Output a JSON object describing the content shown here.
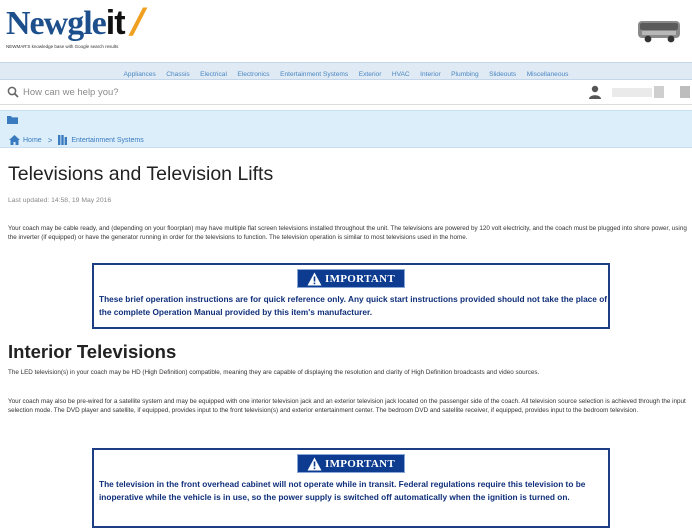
{
  "header": {
    "logo_main": "Newgle",
    "logo_it": "it",
    "logo_tagline": "NEWMAR'S knowledge base with Google search results"
  },
  "categories": [
    "Appliances",
    "Chassis",
    "Electrical",
    "Electronics",
    "Entertainment Systems",
    "Exterior",
    "HVAC",
    "Interior",
    "Plumbing",
    "Slideouts",
    "Miscellaneous"
  ],
  "search": {
    "placeholder": "How can we help you?"
  },
  "breadcrumb": {
    "home": "Home",
    "current": "Entertainment Systems"
  },
  "article": {
    "title": "Televisions and Television Lifts",
    "updated": "Last updated: 14:58, 19 May 2016",
    "intro": "Your coach may be cable ready, and (depending on your floorplan) may have multiple flat screen televisions installed throughout the unit.  The televisions are powered by 120 volt electricity, and the coach must be plugged into shore power, using  the inverter (if equipped) or have the generator running in order for the televisions to function. The television operation is similar to most televisions used in the home.",
    "important_label": "IMPORTANT",
    "important_1": "These brief operation instructions are for quick reference only. Any quick start instructions provided should not take the place of the complete Operation Manual provided by this item's manufacturer.",
    "section_title": "Interior Televisions",
    "para_led": "The LED television(s) in your coach may be HD (High Definition) compatible, meaning they are capable of displaying the resolution and clarity of High Definition broadcasts and video sources.",
    "para_satellite": "Your coach may also be pre-wired for a satellite system and may be equipped with one interior television jack and an exterior television jack located on the passenger side of the coach.  All television source selection is achieved through the input selection mode. The DVD player and satellite, if equipped, provides input to the front television(s) and exterior entertainment center. The bedroom DVD and satellite receiver, if equipped, provides input to the bedroom television.",
    "important_2": "The television in the front overhead cabinet will not operate while in transit. Federal regulations require this television to be inoperative while the vehicle is in use, so the power supply is switched off automatically when the ignition is turned on."
  },
  "colors": {
    "brand_blue": "#1d4f8c",
    "important_border": "#1d3d85",
    "important_badge": "#0c3b8f",
    "nav_bg": "#dfeaf4",
    "crumb_bg": "#dceefa"
  },
  "icons": [
    "rv-motorhome-icon",
    "search-icon",
    "user-icon",
    "folder-icon",
    "home-icon",
    "tv-icon",
    "warning-icon"
  ]
}
